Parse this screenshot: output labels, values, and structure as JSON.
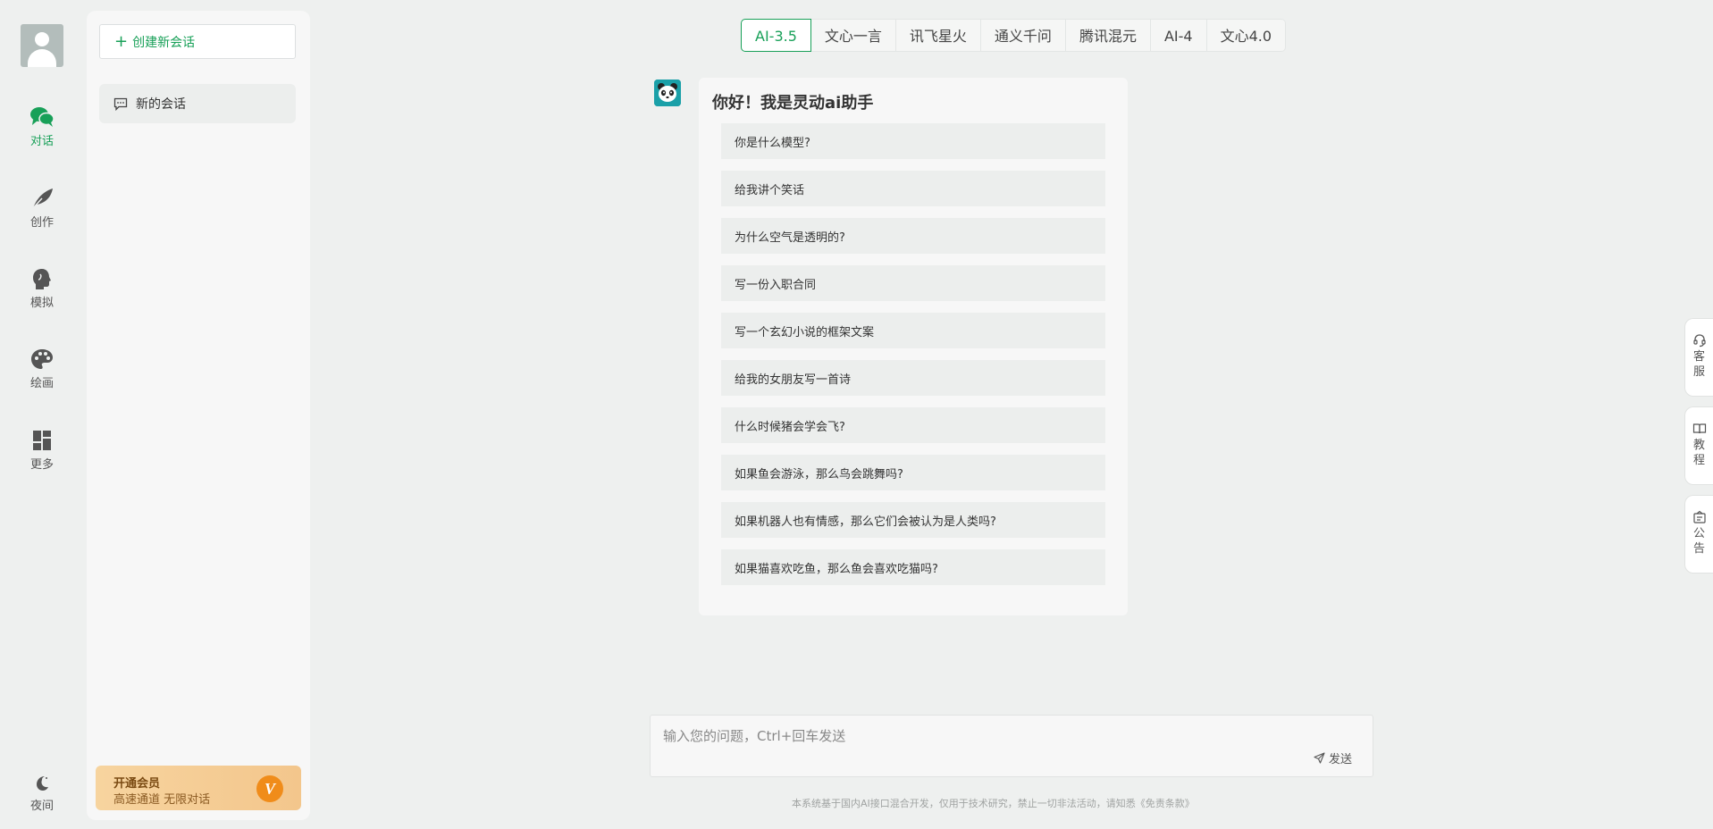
{
  "rail": {
    "items": [
      {
        "label": "对话",
        "icon": "chat-bubbles-icon",
        "active": true
      },
      {
        "label": "创作",
        "icon": "feather-icon",
        "active": false
      },
      {
        "label": "模拟",
        "icon": "head-profile-icon",
        "active": false
      },
      {
        "label": "绘画",
        "icon": "palette-icon",
        "active": false
      },
      {
        "label": "更多",
        "icon": "dashboard-grid-icon",
        "active": false
      }
    ],
    "night_label": "夜间"
  },
  "panel": {
    "new_chat_label": "创建新会话",
    "sessions": [
      {
        "label": "新的会话"
      }
    ],
    "vip": {
      "title": "开通会员",
      "subtitle": "高速通道 无限对话",
      "badge": "V"
    }
  },
  "tabs": [
    "AI-3.5",
    "文心一言",
    "讯飞星火",
    "通义千问",
    "腾讯混元",
    "AI-4",
    "文心4.0"
  ],
  "card": {
    "greeting": "你好！我是灵动ai助手",
    "questions": [
      "你是什么模型?",
      "给我讲个笑话",
      "为什么空气是透明的?",
      "写一份入职合同",
      "写一个玄幻小说的框架文案",
      "给我的女朋友写一首诗",
      "什么时候猪会学会飞?",
      "如果鱼会游泳，那么鸟会跳舞吗?",
      "如果机器人也有情感，那么它们会被认为是人类吗?",
      "如果猫喜欢吃鱼，那么鱼会喜欢吃猫吗?"
    ]
  },
  "float": [
    {
      "label": "客服",
      "icon": "headset-icon"
    },
    {
      "label": "教程",
      "icon": "book-icon"
    },
    {
      "label": "公告",
      "icon": "notice-icon"
    }
  ],
  "input": {
    "placeholder": "输入您的问题，Ctrl+回车发送",
    "send_label": "发送"
  },
  "footer": "本系统基于国内AI接口混合开发，仅用于技术研究，禁止一切非法活动，请知悉《免责条款》",
  "colors": {
    "accent": "#18a058",
    "vip_badge": "#f08c1a"
  }
}
